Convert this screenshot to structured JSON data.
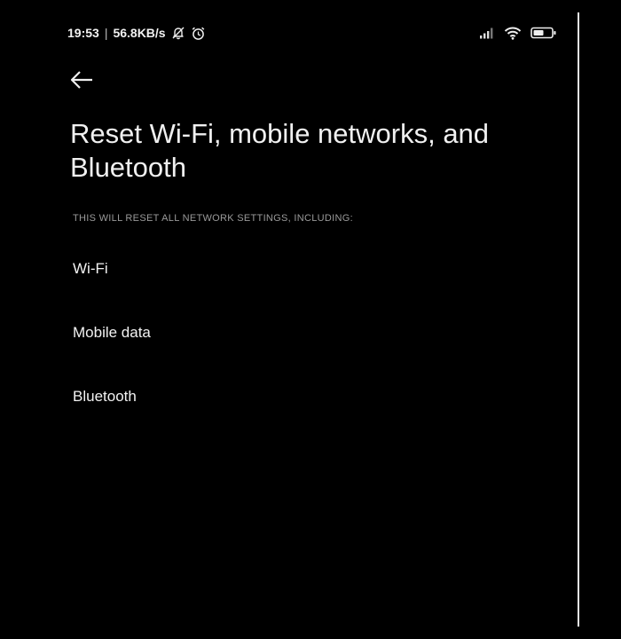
{
  "status_bar": {
    "time": "19:53",
    "separator": "|",
    "network_speed": "56.8KB/s",
    "icons": [
      "notifications-off-icon",
      "alarm-icon",
      "signal-icon",
      "wifi-icon",
      "battery-icon"
    ]
  },
  "header": {
    "back_icon": "arrow-left-icon",
    "title": "Reset Wi-Fi, mobile networks, and Bluetooth"
  },
  "section": {
    "header": "THIS WILL RESET ALL NETWORK SETTINGS, INCLUDING:",
    "items": [
      {
        "label": "Wi-Fi"
      },
      {
        "label": "Mobile data"
      },
      {
        "label": "Bluetooth"
      }
    ]
  },
  "colors": {
    "background": "#000000",
    "text_primary": "#f2f2f2",
    "text_secondary": "#9a9a9a"
  }
}
